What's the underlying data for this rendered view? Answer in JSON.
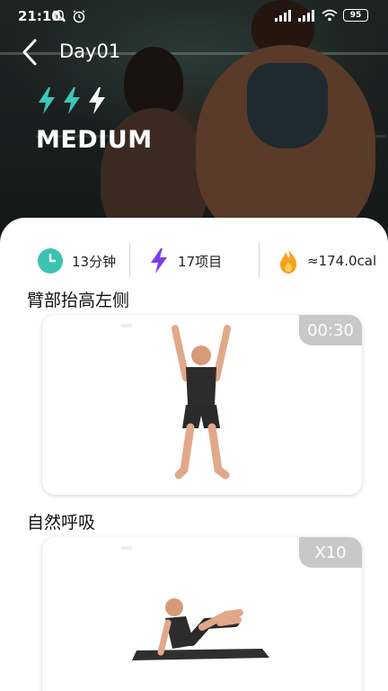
{
  "status_bar": {
    "time": "21:10",
    "battery": "95"
  },
  "header": {
    "title": "Day01",
    "level": "MEDIUM",
    "accent_color": "#3ec7b8"
  },
  "stats": {
    "duration": "13分钟",
    "items": "17项目",
    "calories": "≈174.0cal"
  },
  "exercises": [
    {
      "title": "臂部抬高左侧",
      "badge": "00:30"
    },
    {
      "title": "自然呼吸",
      "badge": "X10"
    }
  ],
  "colors": {
    "clock_icon": "#3cc2b1",
    "bolt_icon": "#7b3fe4",
    "fire_icon": "#f7a11d",
    "badge_bg": "#c8c8c8"
  }
}
